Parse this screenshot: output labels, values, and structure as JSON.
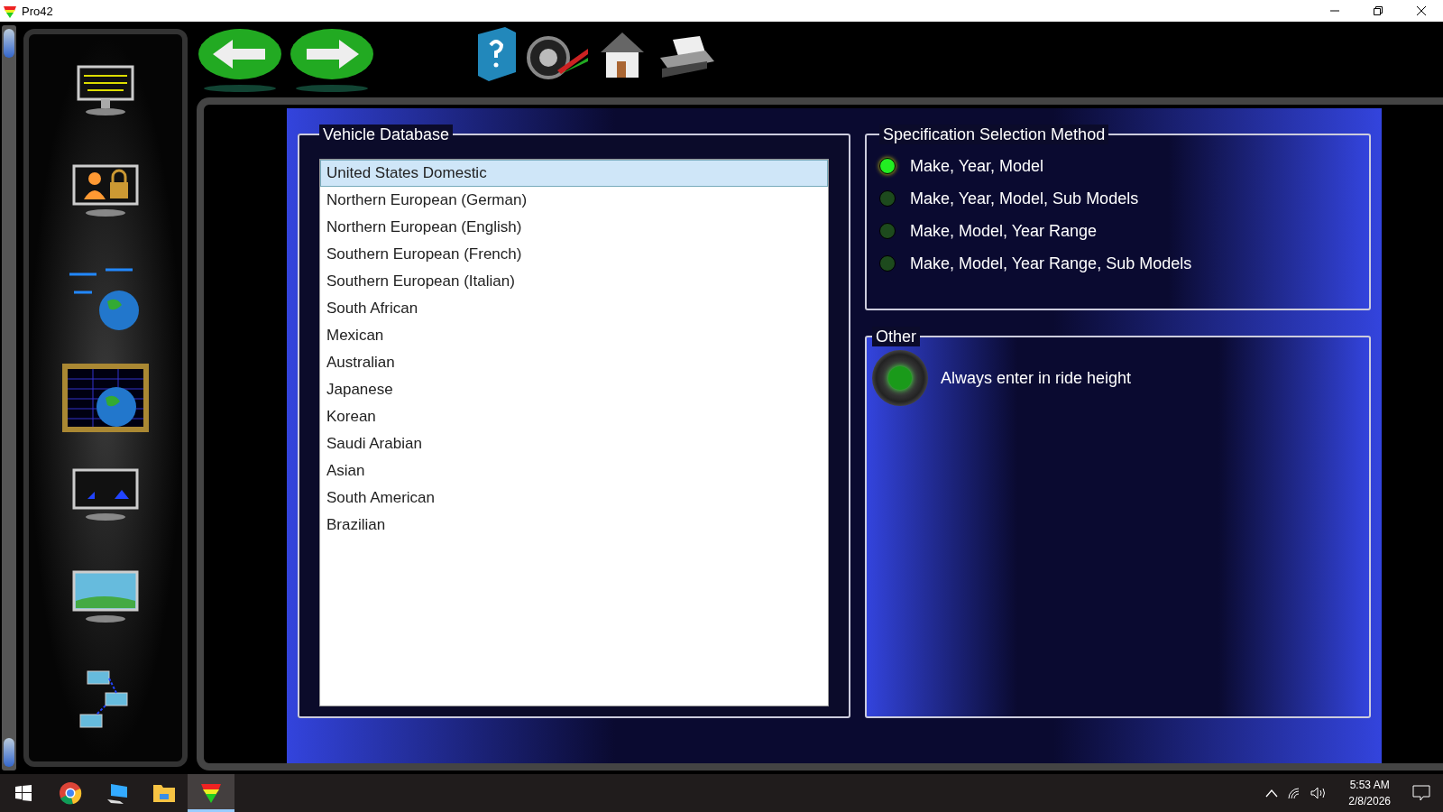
{
  "window": {
    "title": "Pro42"
  },
  "vehicle_database": {
    "title": "Vehicle Database",
    "items": [
      {
        "label": "United States Domestic",
        "selected": true
      },
      {
        "label": "Northern European (German)",
        "selected": false
      },
      {
        "label": "Northern European (English)",
        "selected": false
      },
      {
        "label": "Southern European (French)",
        "selected": false
      },
      {
        "label": "Southern European (Italian)",
        "selected": false
      },
      {
        "label": "South African",
        "selected": false
      },
      {
        "label": "Mexican",
        "selected": false
      },
      {
        "label": "Australian",
        "selected": false
      },
      {
        "label": "Japanese",
        "selected": false
      },
      {
        "label": "Korean",
        "selected": false
      },
      {
        "label": "Saudi Arabian",
        "selected": false
      },
      {
        "label": "Asian",
        "selected": false
      },
      {
        "label": "South American",
        "selected": false
      },
      {
        "label": "Brazilian",
        "selected": false
      }
    ]
  },
  "specification_method": {
    "title": "Specification Selection Method",
    "options": [
      {
        "label": "Make, Year, Model",
        "selected": true
      },
      {
        "label": "Make, Year, Model, Sub Models",
        "selected": false
      },
      {
        "label": "Make, Model, Year Range",
        "selected": false
      },
      {
        "label": "Make, Model, Year Range, Sub Models",
        "selected": false
      }
    ]
  },
  "other": {
    "title": "Other",
    "toggles": [
      {
        "label": "Always enter in ride height",
        "on": true
      }
    ]
  },
  "taskbar": {
    "time": "5:53 AM",
    "date": "2/8/2026"
  }
}
